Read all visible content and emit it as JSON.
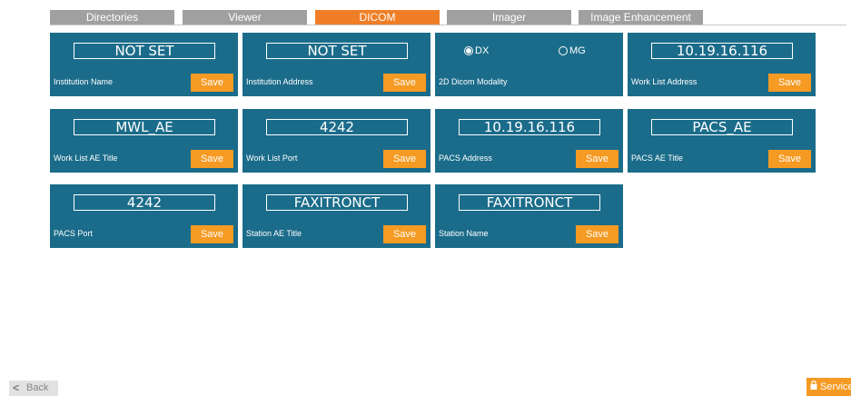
{
  "tabs": [
    {
      "label": "Directories"
    },
    {
      "label": "Viewer"
    },
    {
      "label": "DICOM"
    },
    {
      "label": "Imager"
    },
    {
      "label": "Image Enhancement"
    }
  ],
  "active_tab": "DICOM",
  "cards": {
    "institution_name": {
      "value": "NOT SET",
      "label": "Institution Name",
      "save": "Save"
    },
    "institution_address": {
      "value": "NOT SET",
      "label": "Institution Address",
      "save": "Save"
    },
    "dicom_modality": {
      "label": "2D Dicom Modality",
      "option_dx": "DX",
      "option_mg": "MG",
      "selected": "DX"
    },
    "work_list_address": {
      "value": "10.19.16.116",
      "label": "Work List Address",
      "save": "Save"
    },
    "work_list_ae_title": {
      "value": "MWL_AE",
      "label": "Work List AE Title",
      "save": "Save"
    },
    "work_list_port": {
      "value": "4242",
      "label": "Work List Port",
      "save": "Save"
    },
    "pacs_address": {
      "value": "10.19.16.116",
      "label": "PACS Address",
      "save": "Save"
    },
    "pacs_ae_title": {
      "value": "PACS_AE",
      "label": "PACS AE Title",
      "save": "Save"
    },
    "pacs_port": {
      "value": "4242",
      "label": "PACS Port",
      "save": "Save"
    },
    "station_ae_title": {
      "value": "FAXITRONCT",
      "label": "Station AE Title",
      "save": "Save"
    },
    "station_name": {
      "value": "FAXITRONCT",
      "label": "Station Name",
      "save": "Save"
    }
  },
  "footer": {
    "back_label": "Back",
    "service_label": "Service"
  },
  "colors": {
    "card": "#1b6c8a",
    "accent": "#f59a23",
    "active_tab": "#f07e26",
    "tab": "#a0a0a0"
  }
}
